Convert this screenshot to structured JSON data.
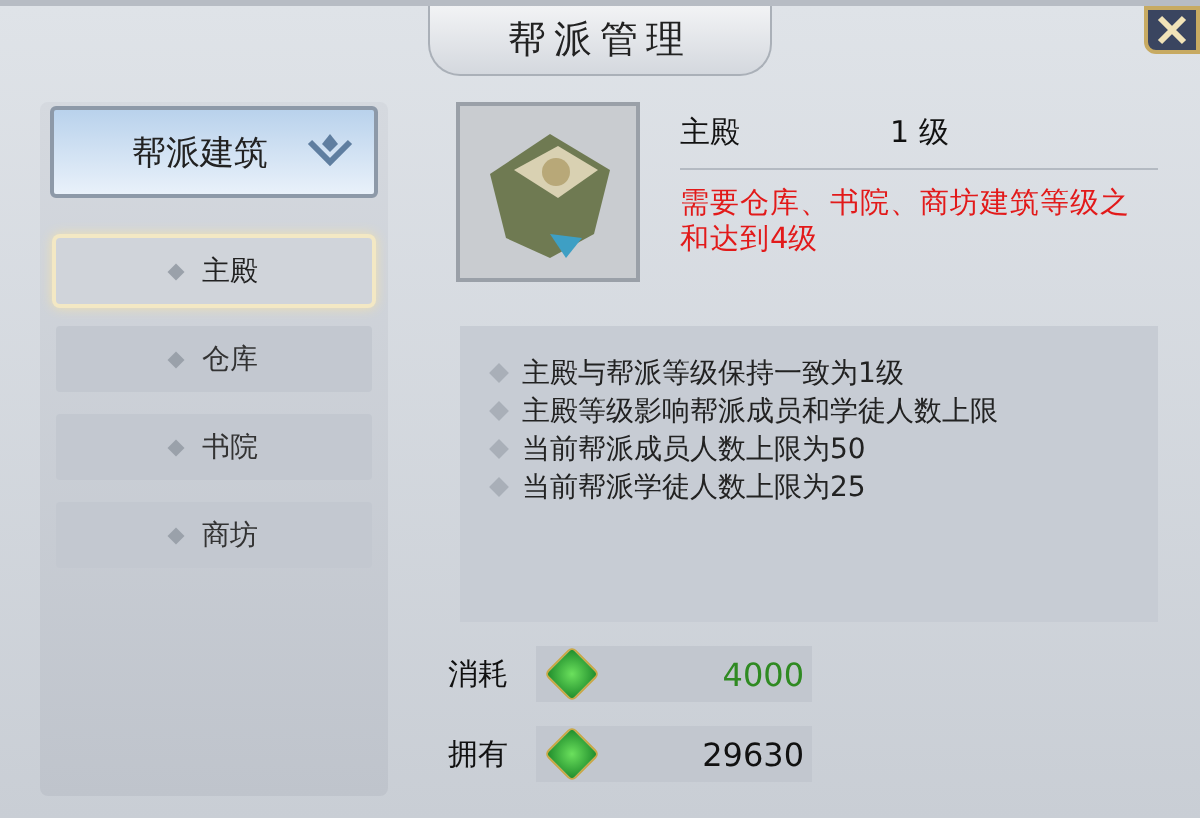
{
  "window": {
    "title": "帮派管理"
  },
  "category": {
    "label": "帮派建筑"
  },
  "buildings": [
    {
      "label": "主殿",
      "selected": true
    },
    {
      "label": "仓库",
      "selected": false
    },
    {
      "label": "书院",
      "selected": false
    },
    {
      "label": "商坊",
      "selected": false
    }
  ],
  "detail": {
    "name": "主殿",
    "level": "1 级",
    "requirement": "需要仓库、书院、商坊建筑等级之和达到4级",
    "effects": [
      "主殿与帮派等级保持一致为1级",
      "主殿等级影响帮派成员和学徒人数上限",
      "当前帮派成员人数上限为50",
      "当前帮派学徒人数上限为25"
    ]
  },
  "resources": [
    {
      "kind": "cost",
      "label": "消耗",
      "amount": "4000"
    },
    {
      "kind": "owned",
      "label": "拥有",
      "amount": "29630"
    }
  ]
}
